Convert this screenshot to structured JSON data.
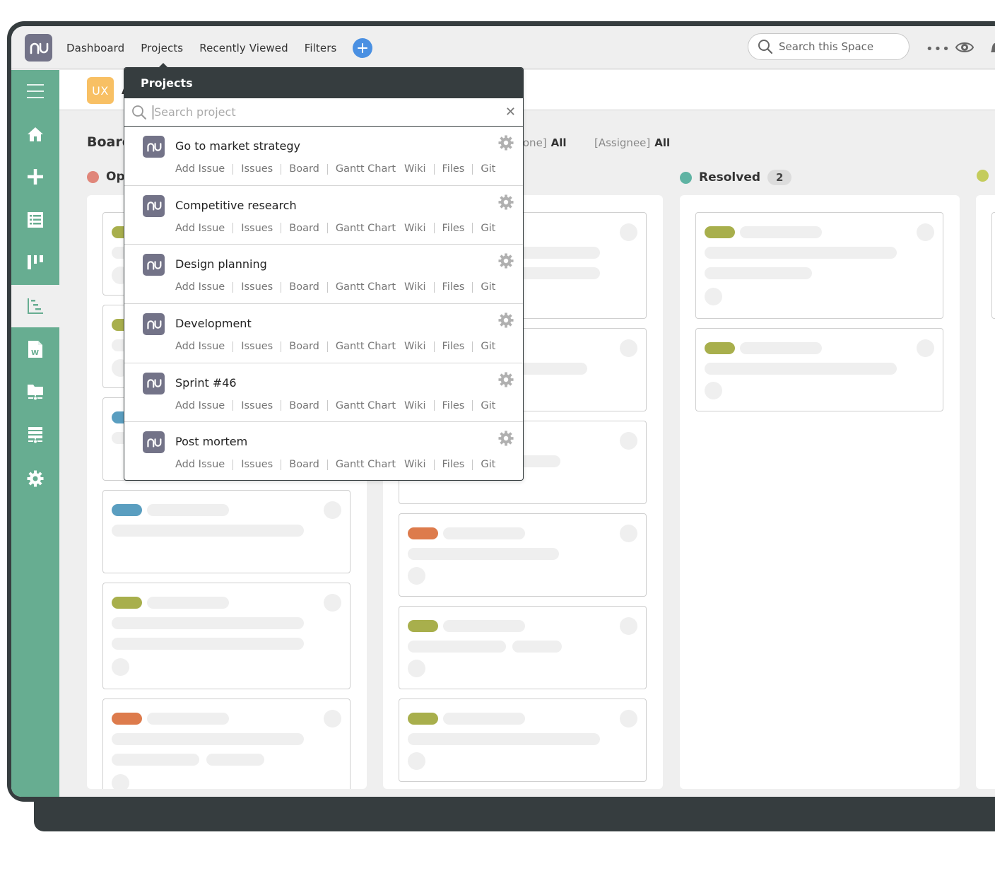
{
  "topbar": {
    "logo_text": "nu",
    "nav": [
      "Dashboard",
      "Projects",
      "Recently Viewed",
      "Filters"
    ],
    "add_button_icon": "plus-icon",
    "search_placeholder": "Search this Space",
    "more_icon": "more-horizontal-icon",
    "watch_icon": "eye-icon",
    "notifications_icon": "bell-icon"
  },
  "sidebar": {
    "items": [
      {
        "icon": "menu-icon",
        "active": false
      },
      {
        "icon": "home-icon",
        "active": false
      },
      {
        "icon": "plus-icon",
        "active": false
      },
      {
        "icon": "list-icon",
        "active": false
      },
      {
        "icon": "board-icon",
        "active": false
      },
      {
        "icon": "gantt-icon",
        "active": true
      },
      {
        "icon": "wiki-document-icon",
        "active": false
      },
      {
        "icon": "shared-folder-icon",
        "active": false
      },
      {
        "icon": "git-server-icon",
        "active": false
      },
      {
        "icon": "settings-icon",
        "active": false
      }
    ]
  },
  "project": {
    "badge": "UX",
    "name": "A"
  },
  "board": {
    "title": "Board",
    "filters": [
      {
        "label": "[Milestone]",
        "visible_label": "tone]",
        "value": "All"
      },
      {
        "label": "[Assignee]",
        "value": "All"
      }
    ],
    "columns": [
      {
        "name": "Open",
        "visible_name": "Op",
        "color": "#e0867a",
        "count": null
      },
      {
        "name": "",
        "color": null,
        "count": null
      },
      {
        "name": "Resolved",
        "color": "#5fb3a3",
        "count": "2"
      },
      {
        "name": "",
        "color": "#c4cc5c",
        "count": null
      }
    ],
    "tag_colors": {
      "green": "#a8af4c",
      "blue": "#5a9ec0",
      "orange": "#dd7b4c"
    }
  },
  "dropdown": {
    "title": "Projects",
    "search_placeholder": "Search project",
    "close_icon": "close-icon",
    "projects": [
      {
        "name": "Go to market strategy"
      },
      {
        "name": "Competitive research"
      },
      {
        "name": "Design planning"
      },
      {
        "name": "Development"
      },
      {
        "name": "Sprint #46"
      },
      {
        "name": "Post mortem"
      }
    ],
    "links": [
      "Add Issue",
      "Issues",
      "Board",
      "Gantt Chart",
      "Wiki",
      "Files",
      "Git"
    ]
  }
}
